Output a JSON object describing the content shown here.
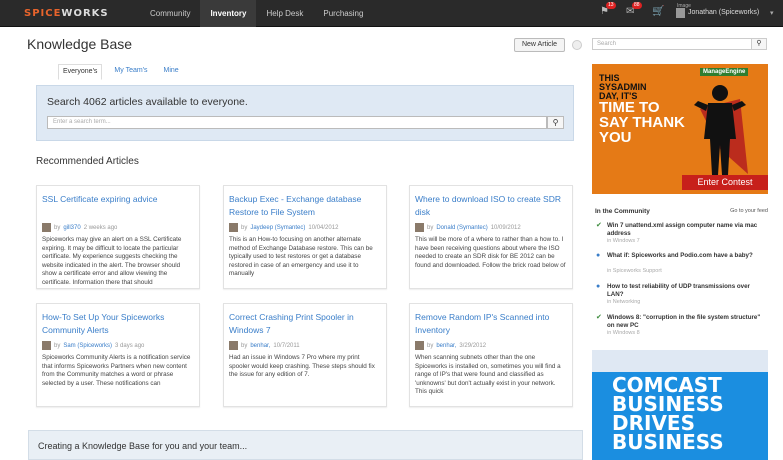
{
  "topbar": {
    "logo_primary": "SPICE",
    "logo_secondary": "WORKS",
    "nav": [
      "Community",
      "Inventory",
      "Help Desk",
      "Purchasing"
    ],
    "active_nav": "Inventory",
    "badges": [
      "13",
      "88"
    ],
    "user_small": "Image",
    "user_name": "Jonathan (Spiceworks)"
  },
  "page": {
    "title": "Knowledge Base",
    "new_article": "New Article"
  },
  "tabs": [
    "Everyone's",
    "My Team's",
    "Mine"
  ],
  "search": {
    "heading": "Search 4062 articles available to everyone.",
    "placeholder": "Enter a search term..."
  },
  "recommended_heading": "Recommended Articles",
  "articles": [
    {
      "title": "SSL Certificate expiring advice",
      "author": "gill370",
      "date": "2 weeks ago",
      "body": "Spiceworks may give an alert on a SSL Certificate expiring. It may be difficult to locate the particular certificate. My experience suggests checking the website indicated in the alert. The browser should show a certificate error and allow viewing the certificate. Information there that should"
    },
    {
      "title": "Backup Exec - Exchange database Restore to File System",
      "author": "Jaydeep (Symantec)",
      "date": "10/04/2012",
      "body": "This is an How-to focusing on another alternate method of Exchange Database restore. This can be typically used to test restores or get a database restored in case of an emergency and use it to manually"
    },
    {
      "title": "Where to download ISO to create SDR disk",
      "author": "Donald (Symantec)",
      "date": "10/09/2012",
      "body": "This will be more of a where to rather than a how to. I have been receiving questions about where the ISO needed to create an SDR disk for BE 2012 can be found and downloaded. Follow the brick road below of"
    },
    {
      "title": "How-To Set Up Your Spiceworks Community Alerts",
      "author": "Sam (Spiceworks)",
      "date": "3 days ago",
      "body": "Spiceworks Community Alerts is a notification service that informs Spiceworks Partners when new content from the Community matches a word or phrase selected by a user. These notifications can"
    },
    {
      "title": "Correct Crashing Print Spooler in Windows 7",
      "author": "benhar,",
      "date": "10/7/2011",
      "body": "Had an issue in Windows 7 Pro where my print spooler would keep crashing. These steps should fix the issue for any edition of 7."
    },
    {
      "title": "Remove Random IP's Scanned into Inventory",
      "author": "benhar,",
      "date": "3/29/2012",
      "body": "When scanning subnets other than the one Spiceworks is installed on, sometimes you will find a range of IP's that were found and classified as 'unknowns' but don't actually exist in your network. This quick"
    }
  ],
  "creating_text": "Creating a Knowledge Base for you and your team...",
  "sidebar": {
    "search_placeholder": "Search",
    "ad1": {
      "small": "THIS SYSADMIN DAY, IT'S",
      "big": "TIME TO SAY THANK YOU",
      "brand": "ManageEngine",
      "cta": "Enter Contest"
    },
    "community_title": "In the Community",
    "community_feed": "Go to your feed",
    "community_items": [
      {
        "title": "Win 7 unattend.xml assign computer name via mac address",
        "sub": "in Windows 7"
      },
      {
        "title": "What if: Spiceworks and Podio.com have a baby?",
        "sub": "in Spiceworks Support"
      },
      {
        "title": "How to test reliability of UDP transmissions over LAN?",
        "sub": "in Networking"
      },
      {
        "title": "Windows 8: \"corruption in the file system structure\" on new PC",
        "sub": "in Windows 8"
      }
    ],
    "ad2_lines": [
      "COMCAST",
      "BUSINESS",
      "DRIVES",
      "BUSINESS"
    ]
  },
  "colors": {
    "topbar": "#2a2a2a",
    "link": "#3a7ec9",
    "search_panel": "#dfe9f4",
    "ad_orange": "#e57a16",
    "ad_blue": "#1b8ee0"
  }
}
